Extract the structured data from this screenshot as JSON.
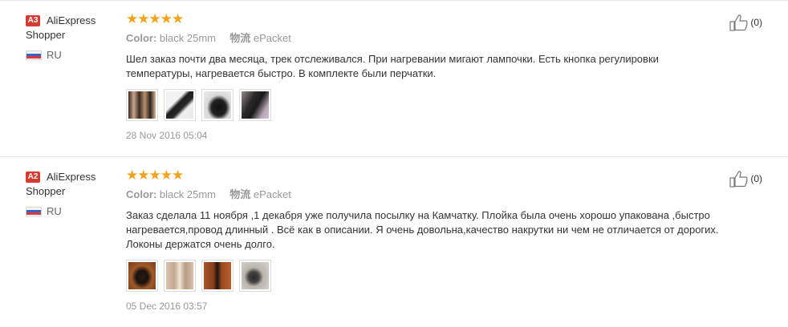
{
  "reviews": [
    {
      "badge": "A3",
      "user_line1": "AliExpress",
      "user_line2": "Shopper",
      "country": "RU",
      "stars": "★★★★★",
      "color_label": "Color:",
      "color_value": "black 25mm",
      "shipping_label": "物流",
      "shipping_value": "ePacket",
      "text": "Шел заказ почти два месяца, трек отслеживался. При нагревании мигают лампочки. Есть кнопка регулировки температуры, нагревается быстро. В комплекте были перчатки.",
      "date": "28 Nov 2016 05:04",
      "likes": "(0)",
      "thumbnails": [
        "photo",
        "photo",
        "photo",
        "photo"
      ]
    },
    {
      "badge": "A2",
      "user_line1": "AliExpress",
      "user_line2": "Shopper",
      "country": "RU",
      "stars": "★★★★★",
      "color_label": "Color:",
      "color_value": "black 25mm",
      "shipping_label": "物流",
      "shipping_value": "ePacket",
      "text": "Заказ сделала 11 ноября ,1 декабря уже получила посылку на Камчатку. Плойка была очень хорошо упакована ,быстро нагревается,провод длинный . Всё как в описании. Я очень довольна,качество накрутки ни чем не отличается от дорогих. Локоны держатся очень долго.",
      "date": "05 Dec 2016 03:57",
      "likes": "(0)",
      "thumbnails": [
        "photo",
        "photo",
        "photo",
        "photo"
      ]
    }
  ],
  "colors": {
    "star": "#f7a21b",
    "badge": "#d73a30"
  }
}
